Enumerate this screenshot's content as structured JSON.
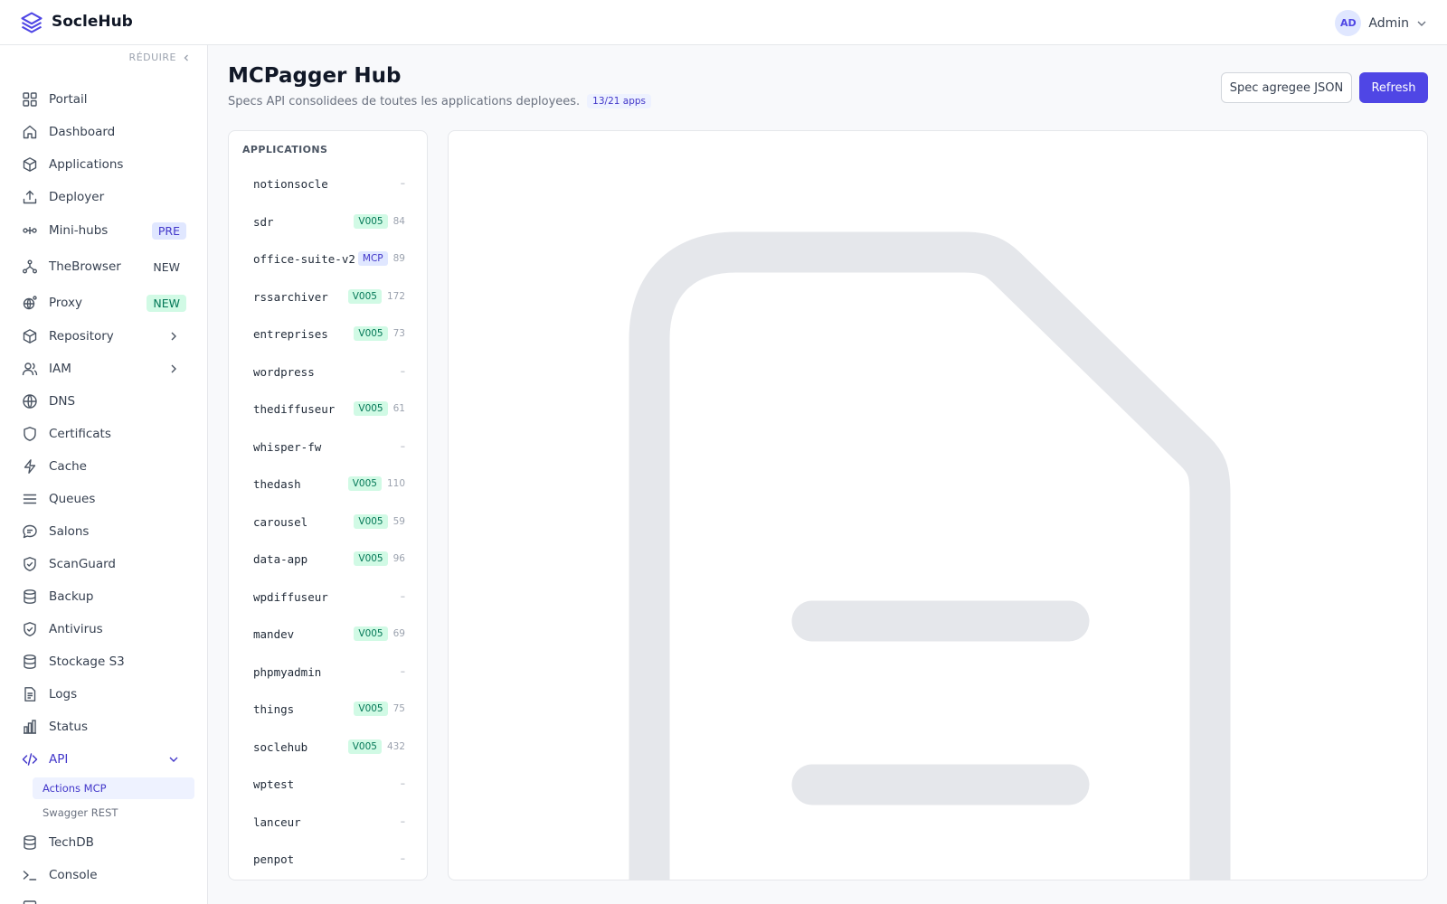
{
  "app": {
    "brand": "SocleHub"
  },
  "user": {
    "initials": "AD",
    "name": "Admin"
  },
  "sidebar": {
    "collapse_label": "RÉDUIRE",
    "items": [
      {
        "label": "Portail",
        "icon": "grid-icon"
      },
      {
        "label": "Dashboard",
        "icon": "home-icon"
      },
      {
        "label": "Applications",
        "icon": "cube-icon"
      },
      {
        "label": "Deployer",
        "icon": "upload-icon"
      },
      {
        "label": "Mini-hubs",
        "icon": "nodes-icon",
        "badge": "PRE"
      },
      {
        "label": "TheBrowser",
        "icon": "network-icon",
        "badge": "NEW"
      },
      {
        "label": "Proxy",
        "icon": "proxy-icon",
        "badge": "NEW"
      },
      {
        "label": "Repository",
        "icon": "cube-icon"
      },
      {
        "label": "IAM",
        "icon": "users-icon"
      },
      {
        "label": "DNS",
        "icon": "globe-icon"
      },
      {
        "label": "Certificats",
        "icon": "shield-icon"
      },
      {
        "label": "Cache",
        "icon": "bolt-icon"
      },
      {
        "label": "Queues",
        "icon": "list-icon"
      },
      {
        "label": "Salons",
        "icon": "chat-icon"
      },
      {
        "label": "ScanGuard",
        "icon": "shield-check-icon"
      },
      {
        "label": "Backup",
        "icon": "database-icon"
      },
      {
        "label": "Antivirus",
        "icon": "shield-check-icon"
      },
      {
        "label": "Stockage S3",
        "icon": "database-icon"
      },
      {
        "label": "Logs",
        "icon": "file-text-icon"
      },
      {
        "label": "Status",
        "icon": "bar-chart-icon"
      },
      {
        "label": "API",
        "icon": "code-icon"
      },
      {
        "label": "TechDB",
        "icon": "database-icon"
      },
      {
        "label": "Console",
        "icon": "terminal-icon"
      }
    ],
    "api_sub": [
      {
        "label": "Actions MCP"
      },
      {
        "label": "Swagger REST"
      }
    ]
  },
  "page": {
    "title": "MCPagger Hub",
    "subtitle": "Specs API consolidees de toutes les applications deployees.",
    "apps_count": "13/21 apps",
    "spec_button": "Spec agregee JSON",
    "refresh_button": "Refresh"
  },
  "applications": {
    "title": "APPLICATIONS",
    "items": [
      {
        "name": "notionsocle",
        "tag": "",
        "count": "–"
      },
      {
        "name": "sdr",
        "tag": "V005",
        "count": "84"
      },
      {
        "name": "office-suite-v2",
        "tag": "MCP",
        "count": "89"
      },
      {
        "name": "rssarchiver",
        "tag": "V005",
        "count": "172"
      },
      {
        "name": "entreprises",
        "tag": "V005",
        "count": "73"
      },
      {
        "name": "wordpress",
        "tag": "",
        "count": "–"
      },
      {
        "name": "thediffuseur",
        "tag": "V005",
        "count": "61"
      },
      {
        "name": "whisper-fw",
        "tag": "",
        "count": "–"
      },
      {
        "name": "thedash",
        "tag": "V005",
        "count": "110"
      },
      {
        "name": "carousel",
        "tag": "V005",
        "count": "59"
      },
      {
        "name": "data-app",
        "tag": "V005",
        "count": "96"
      },
      {
        "name": "wpdiffuseur",
        "tag": "",
        "count": "–"
      },
      {
        "name": "mandev",
        "tag": "V005",
        "count": "69"
      },
      {
        "name": "phpmyadmin",
        "tag": "",
        "count": "–"
      },
      {
        "name": "things",
        "tag": "V005",
        "count": "75"
      },
      {
        "name": "soclehub",
        "tag": "V005",
        "count": "432"
      },
      {
        "name": "wptest",
        "tag": "",
        "count": "–"
      },
      {
        "name": "lanceur",
        "tag": "",
        "count": "–"
      },
      {
        "name": "penpot",
        "tag": "",
        "count": "–"
      }
    ]
  },
  "colors": {
    "accent": "#4f46e5",
    "badge_green": "#047857",
    "badge_indigo": "#4338ca",
    "empty_icon": "#e5e7eb"
  },
  "content": {
    "empty_icon": "file-icon"
  }
}
